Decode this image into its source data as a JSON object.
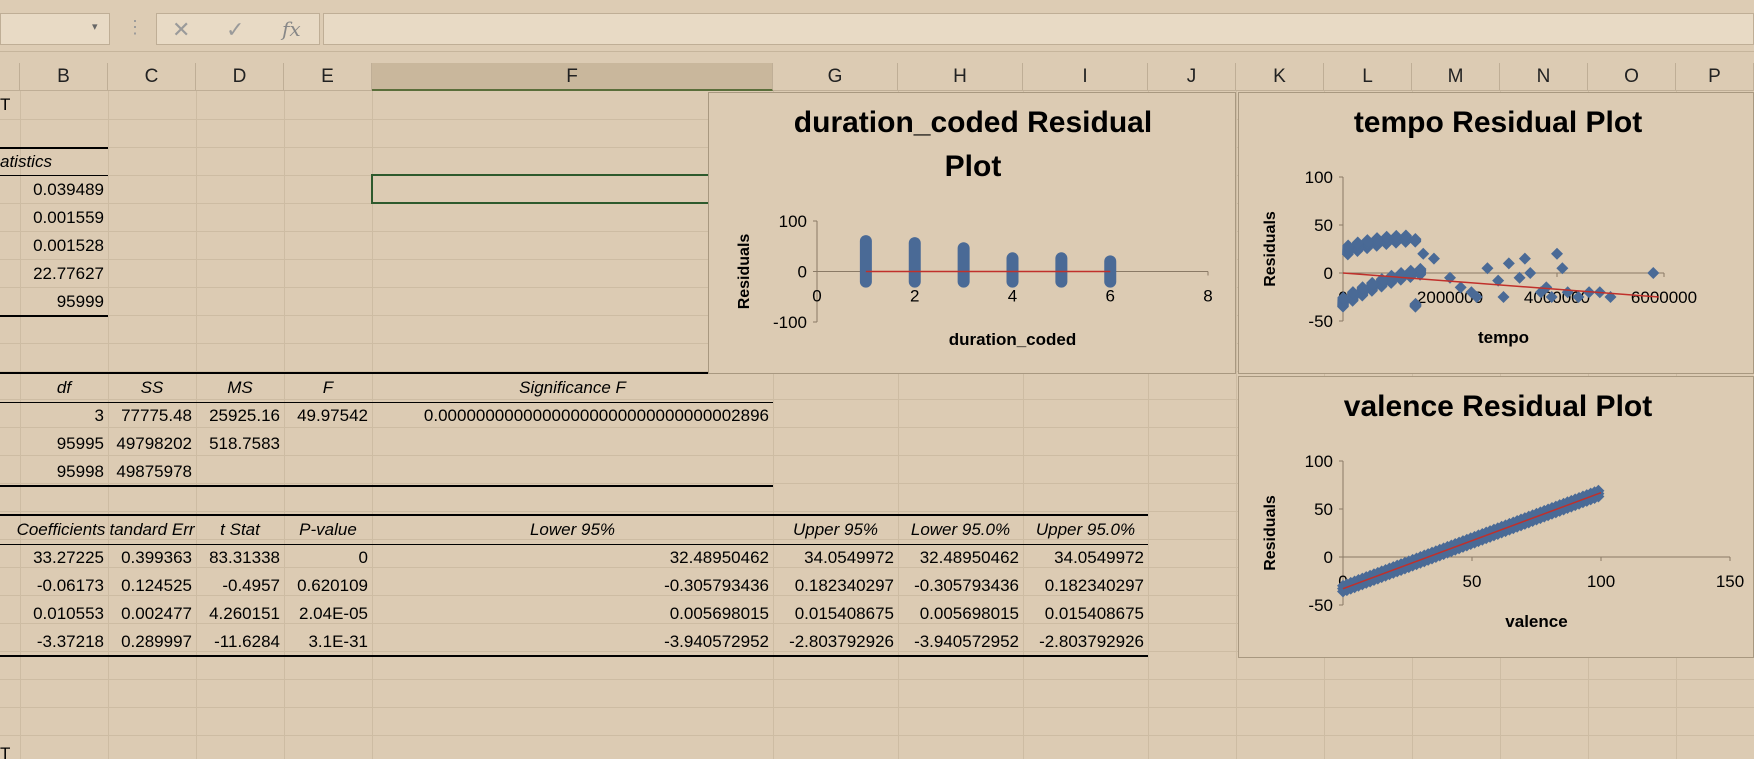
{
  "formula_bar": {
    "cancel_glyph": "✕",
    "enter_glyph": "✓",
    "fx_label": "fx",
    "namebox_value": "",
    "formula_value": ""
  },
  "columns": [
    "B",
    "C",
    "D",
    "E",
    "F",
    "G",
    "H",
    "I",
    "J",
    "K",
    "L",
    "M",
    "N",
    "O",
    "P"
  ],
  "selected_column": "F",
  "sheet": {
    "output_title": "T",
    "reg_stats_header": "atistics",
    "reg_stats_values": [
      "0.039489",
      "0.001559",
      "0.001528",
      "22.77627",
      "95999"
    ],
    "anova_headers": {
      "df": "df",
      "ss": "SS",
      "ms": "MS",
      "f": "F",
      "sigf": "Significance F"
    },
    "anova_rows": [
      {
        "df": "3",
        "ss": "77775.48",
        "ms": "25925.16",
        "f": "49.97542",
        "sigf": "0.00000000000000000000000000000002896"
      },
      {
        "df": "95995",
        "ss": "49798202",
        "ms": "518.7583",
        "f": "",
        "sigf": ""
      },
      {
        "df": "95998",
        "ss": "49875978",
        "ms": "",
        "f": "",
        "sigf": ""
      }
    ],
    "coef_headers": {
      "coef": "Coefficients",
      "se": "tandard Err",
      "t": "t Stat",
      "p": "P-value",
      "l95": "Lower 95%",
      "u95": "Upper 95%",
      "l950": "Lower 95.0%",
      "u950": "Upper 95.0%"
    },
    "coef_rows": [
      {
        "coef": "33.27225",
        "se": "0.399363",
        "t": "83.31338",
        "p": "0",
        "l95": "32.48950462",
        "u95": "34.0549972",
        "l950": "32.48950462",
        "u950": "34.0549972"
      },
      {
        "coef": "-0.06173",
        "se": "0.124525",
        "t": "-0.4957",
        "p": "0.620109",
        "l95": "-0.305793436",
        "u95": "0.182340297",
        "l950": "-0.305793436",
        "u950": "0.182340297"
      },
      {
        "coef": "0.010553",
        "se": "0.002477",
        "t": "4.260151",
        "p": "2.04E-05",
        "l95": "0.005698015",
        "u95": "0.015408675",
        "l950": "0.005698015",
        "u950": "0.015408675"
      },
      {
        "coef": "-3.37218",
        "se": "0.289997",
        "t": "-11.6284",
        "p": "3.1E-31",
        "l95": "-3.940572952",
        "u95": "-2.803792926",
        "l950": "-3.940572952",
        "u950": "-2.803792926"
      }
    ],
    "bottom_label": "T"
  },
  "colors": {
    "marker": "#4a6a96",
    "trend": "#c0302b",
    "bg": "#dccbb3"
  },
  "chart_data": [
    {
      "type": "scatter",
      "title": "duration_coded  Residual Plot",
      "title_lines": [
        "duration_coded  Residual",
        "Plot"
      ],
      "xlabel": "duration_coded",
      "ylabel": "Residuals",
      "xlim": [
        0,
        8
      ],
      "ylim": [
        -100,
        100
      ],
      "xticks": [
        "0",
        "2",
        "4",
        "6",
        "8"
      ],
      "yticks": [
        "100",
        "0",
        "-100"
      ],
      "columns": [
        {
          "x": 1,
          "ymin": -32,
          "ymax": 72
        },
        {
          "x": 2,
          "ymin": -32,
          "ymax": 68
        },
        {
          "x": 3,
          "ymin": -32,
          "ymax": 58
        },
        {
          "x": 4,
          "ymin": -32,
          "ymax": 38
        },
        {
          "x": 5,
          "ymin": -32,
          "ymax": 38
        },
        {
          "x": 6,
          "ymin": -32,
          "ymax": 32
        }
      ],
      "trend": [
        [
          1,
          0
        ],
        [
          6,
          0
        ]
      ]
    },
    {
      "type": "scatter",
      "title": "tempo  Residual Plot",
      "xlabel": "tempo",
      "ylabel": "Residuals",
      "xlim": [
        0,
        6000000
      ],
      "ylim": [
        -50,
        100
      ],
      "xticks": [
        "0",
        "2000000",
        "4000000",
        "6000000"
      ],
      "yticks": [
        "100",
        "50",
        "0",
        "-50"
      ],
      "points": [
        [
          1500000,
          20
        ],
        [
          1700000,
          15
        ],
        [
          2000000,
          -5
        ],
        [
          2200000,
          -15
        ],
        [
          2400000,
          -20
        ],
        [
          2700000,
          5
        ],
        [
          2900000,
          -8
        ],
        [
          3000000,
          -25
        ],
        [
          3100000,
          10
        ],
        [
          3300000,
          -5
        ],
        [
          3400000,
          15
        ],
        [
          3500000,
          0
        ],
        [
          3700000,
          -20
        ],
        [
          3900000,
          -25
        ],
        [
          4000000,
          20
        ],
        [
          4100000,
          5
        ],
        [
          4200000,
          -20
        ],
        [
          4400000,
          -25
        ],
        [
          4600000,
          -20
        ],
        [
          4800000,
          -20
        ],
        [
          5000000,
          -25
        ],
        [
          5800000,
          0
        ],
        [
          3800000,
          -15
        ],
        [
          2500000,
          -25
        ]
      ],
      "trend": [
        [
          0,
          0
        ],
        [
          5900000,
          -25
        ]
      ]
    },
    {
      "type": "scatter",
      "title": "valence  Residual Plot",
      "xlabel": "valence",
      "ylabel": "Residuals",
      "xlim": [
        0,
        150
      ],
      "ylim": [
        -50,
        100
      ],
      "xticks": [
        "0",
        "50",
        "100",
        "150"
      ],
      "yticks": [
        "100",
        "50",
        "0",
        "-50"
      ],
      "trend": [
        [
          0,
          -33
        ],
        [
          100,
          67
        ]
      ]
    }
  ]
}
